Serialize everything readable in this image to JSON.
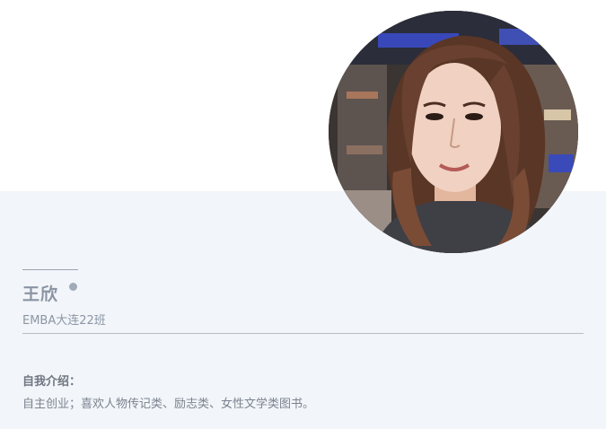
{
  "profile": {
    "name": "王欣",
    "class": "EMBA大连22班",
    "intro_label": "自我介绍：",
    "intro_text": "自主创业；喜欢人物传记类、励志类、女性文学类图书。"
  },
  "colors": {
    "panel_bg": "#f2f5f9",
    "name_text": "#8a94a3",
    "divider": "#b5bfcb"
  }
}
